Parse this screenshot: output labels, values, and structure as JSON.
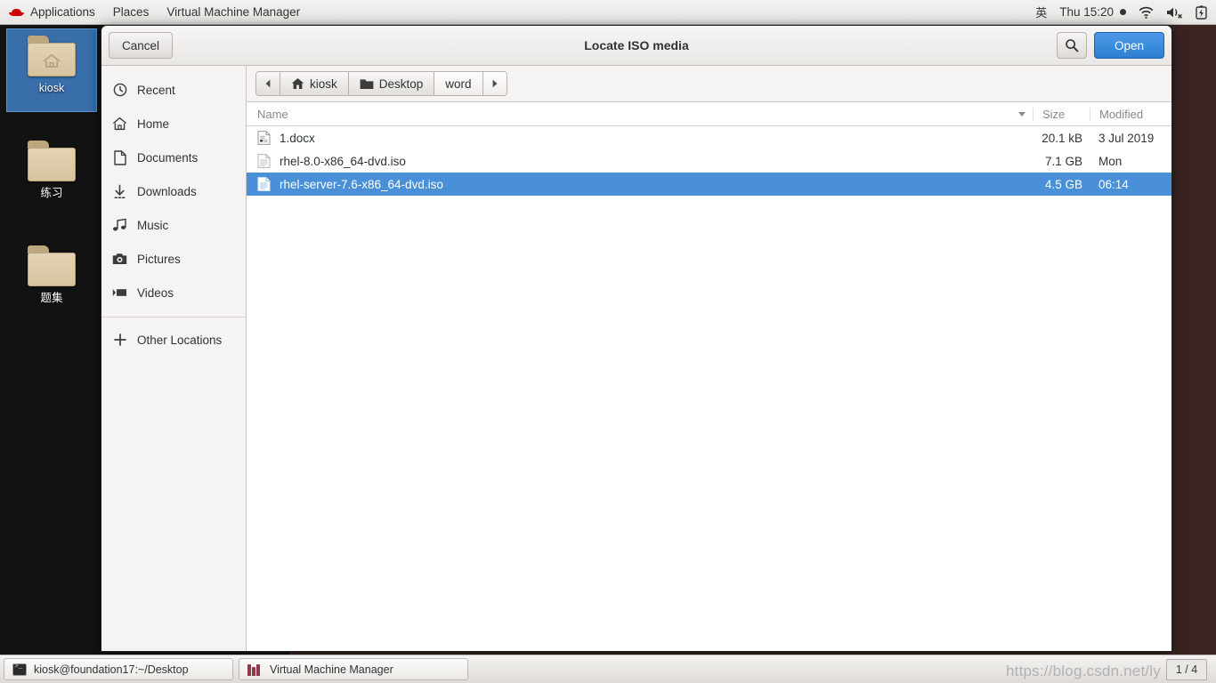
{
  "topbar": {
    "logo_icon": "redhat-logo-icon",
    "items": [
      {
        "label": "Applications",
        "active": false
      },
      {
        "label": "Places",
        "active": false
      },
      {
        "label": "Virtual Machine Manager",
        "active": false
      }
    ],
    "ime_indicator": "英",
    "clock": "Thu 15:20",
    "icons": [
      "wifi-icon",
      "volume-muted-icon",
      "battery-charging-icon"
    ]
  },
  "desktop": {
    "icons": [
      {
        "label": "kiosk",
        "type": "home-folder",
        "selected": true
      },
      {
        "label": "练习",
        "type": "folder",
        "selected": false
      },
      {
        "label": "题集",
        "type": "folder",
        "selected": false
      }
    ]
  },
  "dialog": {
    "title": "Locate ISO media",
    "cancel_label": "Cancel",
    "open_label": "Open",
    "search_icon": "search-icon",
    "sidebar": {
      "items": [
        {
          "label": "Recent",
          "icon": "clock-icon"
        },
        {
          "label": "Home",
          "icon": "home-icon"
        },
        {
          "label": "Documents",
          "icon": "document-icon"
        },
        {
          "label": "Downloads",
          "icon": "download-icon"
        },
        {
          "label": "Music",
          "icon": "music-note-icon"
        },
        {
          "label": "Pictures",
          "icon": "camera-icon"
        },
        {
          "label": "Videos",
          "icon": "video-icon"
        }
      ],
      "other_locations": {
        "label": "Other Locations",
        "icon": "plus-icon"
      }
    },
    "pathbar": {
      "back_icon": "chevron-left-icon",
      "forward_icon": "chevron-right-icon",
      "crumbs": [
        {
          "label": "kiosk",
          "icon": "home-icon",
          "current": false
        },
        {
          "label": "Desktop",
          "icon": "folder-icon",
          "current": false
        },
        {
          "label": "word",
          "icon": "",
          "current": true
        }
      ]
    },
    "columns": {
      "name": "Name",
      "size": "Size",
      "modified": "Modified",
      "sort_icon": "sort-descending-icon"
    },
    "files": [
      {
        "name": "1.docx",
        "size": "20.1 kB",
        "modified": "3 Jul 2019",
        "icon": "docx-file-icon",
        "selected": false
      },
      {
        "name": "rhel-8.0-x86_64-dvd.iso",
        "size": "7.1 GB",
        "modified": "Mon",
        "icon": "file-icon",
        "selected": false
      },
      {
        "name": "rhel-server-7.6-x86_64-dvd.iso",
        "size": "4.5 GB",
        "modified": "06:14",
        "icon": "file-icon",
        "selected": true
      }
    ]
  },
  "taskbar": {
    "tasks": [
      {
        "label": "kiosk@foundation17:~/Desktop",
        "icon": "terminal-icon"
      },
      {
        "label": "Virtual Machine Manager",
        "icon": "vmm-icon"
      }
    ],
    "workspace": "1 / 4",
    "watermark": "https://blog.csdn.net/ly"
  },
  "colors": {
    "selection_blue": "#4a90d9",
    "suggested_blue": "#2f7fd1",
    "desktop_bg": "#121212",
    "vmm_bg": "#3a2421"
  }
}
